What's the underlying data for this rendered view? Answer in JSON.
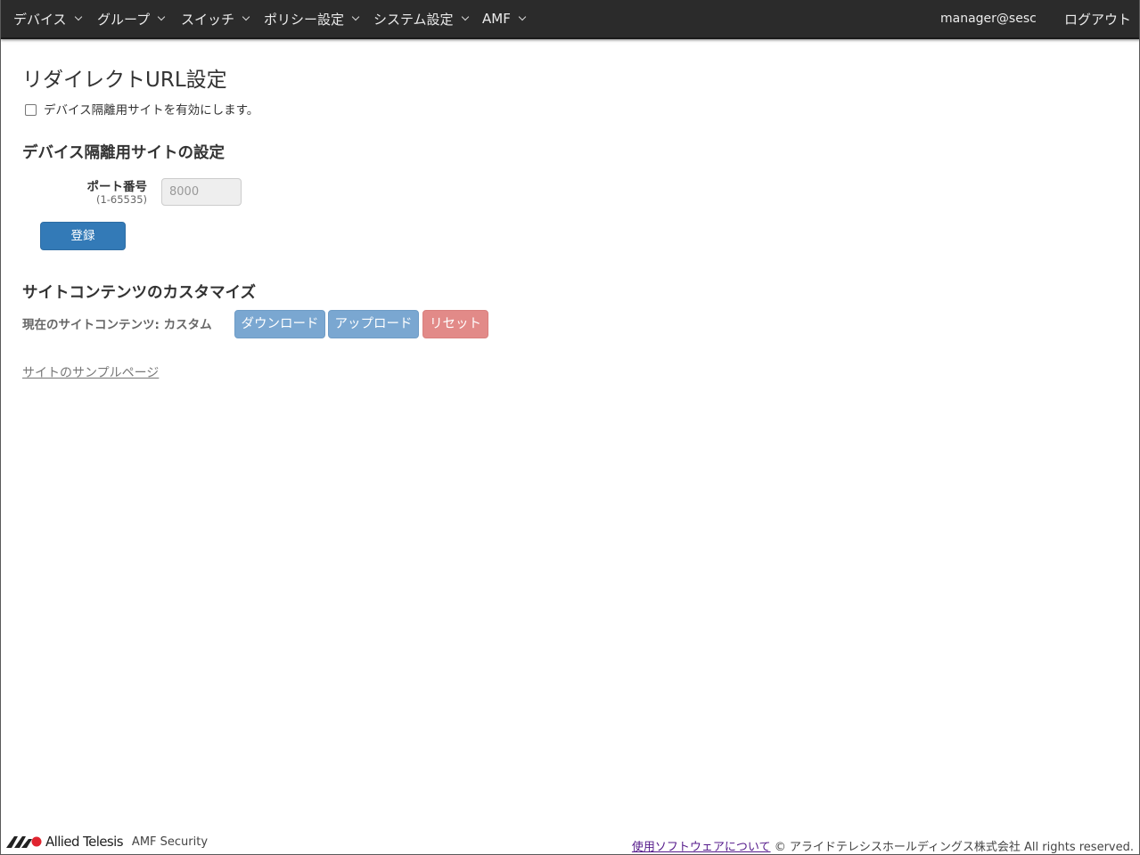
{
  "nav": {
    "items": [
      {
        "label": "デバイス"
      },
      {
        "label": "グループ"
      },
      {
        "label": "スイッチ"
      },
      {
        "label": "ポリシー設定"
      },
      {
        "label": "システム設定"
      },
      {
        "label": "AMF"
      }
    ],
    "user": "manager@sesc",
    "logout": "ログアウト"
  },
  "page": {
    "title": "リダイレクトURL設定",
    "enable_label": "デバイス隔離用サイトを有効にします。",
    "enable_checked": false
  },
  "site_settings": {
    "title": "デバイス隔離用サイトの設定",
    "port_label": "ポート番号",
    "port_range": "(1-65535)",
    "port_value": "8000",
    "submit_label": "登録"
  },
  "customize": {
    "title": "サイトコンテンツのカスタマイズ",
    "current_label": "現在のサイトコンテンツ: カスタム",
    "download_label": "ダウンロード",
    "upload_label": "アップロード",
    "reset_label": "リセット",
    "sample_link": "サイトのサンプルページ"
  },
  "footer": {
    "brand": "Allied Telesis",
    "product": "AMF Security",
    "about_link": "使用ソフトウェアについて",
    "copyright": "© アライドテレシスホールディングス株式会社 All rights reserved."
  },
  "colors": {
    "navbar": "#2b2b2b",
    "primary": "#337ab7",
    "soft_blue": "#7aa7d1",
    "soft_red": "#e28a88",
    "logo_red": "#e0242f"
  }
}
